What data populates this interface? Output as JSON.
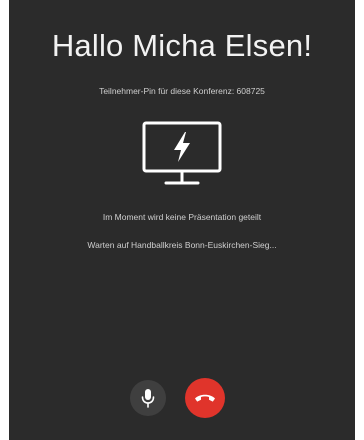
{
  "call": {
    "greeting": "Hallo Micha Elsen!",
    "pin_text": "Teilnehmer-Pin für diese Konferenz: 608725",
    "presentation_status": "Im Moment wird keine Präsentation geteilt",
    "waiting_status": "Warten auf Handballkreis Bonn-Euskirchen-Sieg..."
  },
  "icons": {
    "presentation": "monitor-lightning-icon",
    "mic": "microphone-icon",
    "hangup": "phone-hangup-icon"
  },
  "colors": {
    "background": "#2b2b2b",
    "hangup": "#e0342b",
    "mic_button": "#3f3f3f"
  }
}
